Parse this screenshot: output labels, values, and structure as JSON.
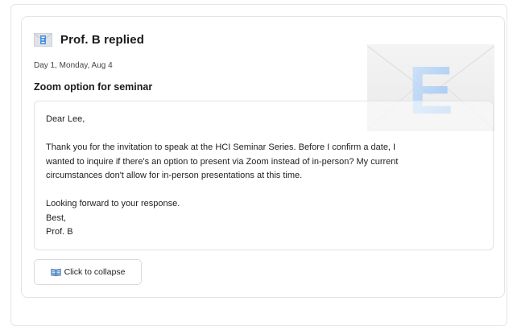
{
  "email": {
    "header": {
      "icon": "envelope-e-icon",
      "title": "Prof. B replied"
    },
    "date": "Day 1, Monday, Aug 4",
    "subject": "Zoom option for seminar",
    "body_lines": [
      "Dear Lee,",
      "",
      "Thank you for the invitation to speak at the HCI Seminar Series. Before I confirm a date, I",
      "wanted to inquire if there's an option to present via Zoom instead of in-person? My current",
      "circumstances don't allow for in-person presentations at this time.",
      "",
      "Looking forward to your response.",
      "Best,",
      "Prof. B"
    ],
    "collapse_button": {
      "icon": "open-book-icon",
      "label": "Click to collapse"
    },
    "watermark": {
      "icon": "envelope-e-icon",
      "letter": "E"
    }
  },
  "colors": {
    "envelope_blue": "#5b9bd5",
    "envelope_light_blue": "#b9d7f5",
    "watermark_blue": "#7fb2ea",
    "border": "#e3e3e3"
  }
}
